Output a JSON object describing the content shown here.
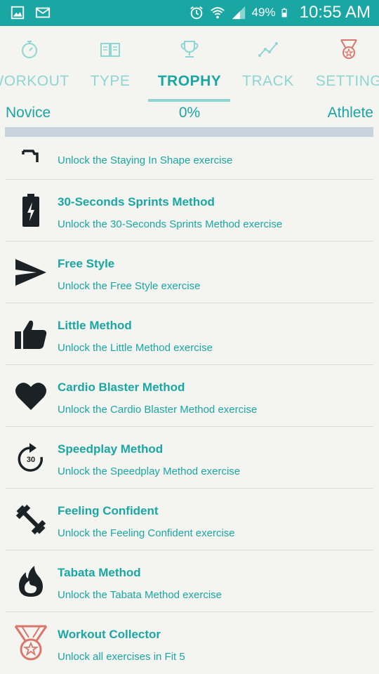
{
  "status_bar": {
    "battery_percent": "49%",
    "time": "10:55 AM",
    "icons": [
      "gallery-icon",
      "mail-icon",
      "alarm-icon",
      "wifi-icon",
      "signal-icon",
      "battery-icon"
    ]
  },
  "tabs": [
    {
      "label": "WORKOUT",
      "icon": "stopwatch-icon",
      "active": false
    },
    {
      "label": "TYPE",
      "icon": "book-icon",
      "active": false
    },
    {
      "label": "TROPHY",
      "icon": "trophy-icon",
      "active": true
    },
    {
      "label": "TRACK",
      "icon": "line-chart-icon",
      "active": false
    },
    {
      "label": "SETTING",
      "icon": "medal-icon",
      "active": false
    }
  ],
  "progress": {
    "left_label": "Novice",
    "percent_label": "0%",
    "right_label": "Athlete",
    "value": 0
  },
  "trophies": [
    {
      "title": "",
      "description": "Unlock the Staying In Shape exercise",
      "icon": "staying-in-shape-icon"
    },
    {
      "title": "30-Seconds Sprints Method",
      "description": "Unlock the 30-Seconds Sprints Method exercise",
      "icon": "battery-charge-icon"
    },
    {
      "title": "Free Style",
      "description": "Unlock the Free Style exercise",
      "icon": "paper-plane-icon"
    },
    {
      "title": "Little Method",
      "description": "Unlock the Little Method exercise",
      "icon": "thumbs-up-icon"
    },
    {
      "title": "Cardio Blaster Method",
      "description": "Unlock the Cardio Blaster Method exercise",
      "icon": "heart-icon"
    },
    {
      "title": "Speedplay Method",
      "description": "Unlock the Speedplay Method exercise",
      "icon": "replay-30-icon",
      "icon_text": "30"
    },
    {
      "title": "Feeling Confident",
      "description": "Unlock the Feeling Confident exercise",
      "icon": "dumbbell-icon"
    },
    {
      "title": "Tabata Method",
      "description": "Unlock the Tabata Method exercise",
      "icon": "flame-icon"
    },
    {
      "title": "Workout Collector",
      "description": "Unlock all exercises in Fit 5",
      "icon": "medal-icon"
    }
  ],
  "colors": {
    "accent": "#1aa7a3",
    "accent_light": "#8fd6d3",
    "progress_track": "#c8d3dc",
    "background": "#f4f4f0",
    "icon": "#1b2226",
    "medal": "#d9776c"
  }
}
